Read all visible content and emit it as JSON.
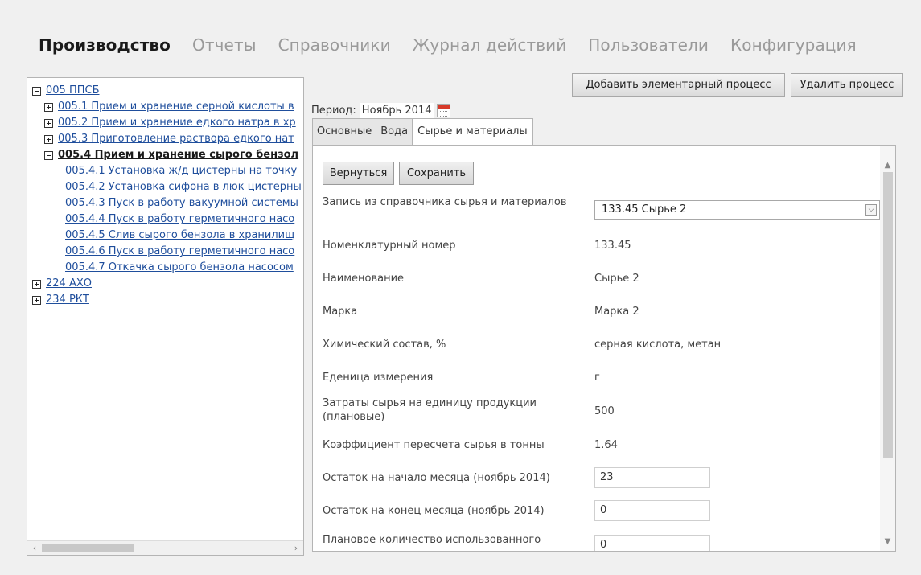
{
  "nav": {
    "items": [
      {
        "label": "Производство",
        "active": true
      },
      {
        "label": "Отчеты"
      },
      {
        "label": "Справочники"
      },
      {
        "label": "Журнал действий"
      },
      {
        "label": "Пользователи"
      },
      {
        "label": "Конфигурация"
      }
    ]
  },
  "tree": {
    "root": "005 ППСБ",
    "children": [
      "005.1 Прием и хранение серной кислоты в",
      "005.2 Прием и хранение едкого натра в хр",
      "005.3 Приготовление раствора едкого нат",
      "005.4 Прием и хранение сырого бензол"
    ],
    "leaves": [
      "005.4.1 Установка ж/д цистерны на точку",
      "005.4.2 Установка сифона в люк цистерны",
      "005.4.3 Пуск в работу вакуумной системы",
      "005.4.4 Пуск в работу герметичного насо",
      "005.4.5 Слив сырого бензола в хранилищ",
      "005.4.6 Пуск в работу герметичного насо",
      "005.4.7 Откачка сырого бензола насосом"
    ],
    "other_roots": [
      "224 АХО",
      "234 РКТ"
    ],
    "scroll_left": "‹",
    "scroll_right": "›"
  },
  "period": {
    "label": "Период:",
    "value": "Ноябрь 2014"
  },
  "actions": {
    "add": "Добавить элементарный процесс",
    "delete": "Удалить процесс"
  },
  "tabs": [
    {
      "label": "Основные"
    },
    {
      "label": "Вода"
    },
    {
      "label": "Сырье и материалы",
      "active": true
    }
  ],
  "form": {
    "back": "Вернуться",
    "save": "Сохранить",
    "material_label": "Запись из справочника сырья и материалов",
    "material_selected": "133.45 Сырье 2",
    "rows": [
      {
        "label": "Номенклатурный номер",
        "value": "133.45"
      },
      {
        "label": "Наименование",
        "value": "Сырье 2"
      },
      {
        "label": "Марка",
        "value": "Марка 2"
      },
      {
        "label": "Химический состав, %",
        "value": "серная кислота, метан"
      },
      {
        "label": "Еденица измерения",
        "value": "г"
      },
      {
        "label": "Затраты сырья на единицу продукции (плановые)",
        "value": "500"
      },
      {
        "label": "Коэффициент пересчета сырья в тонны",
        "value": "1.64"
      }
    ],
    "inputs": [
      {
        "label": "Остаток на начало месяца (ноябрь 2014)",
        "value": "23"
      },
      {
        "label": "Остаток на конец месяца (ноябрь 2014)",
        "value": "0"
      },
      {
        "label": "Плановое количество использованного",
        "value": "0"
      }
    ]
  }
}
